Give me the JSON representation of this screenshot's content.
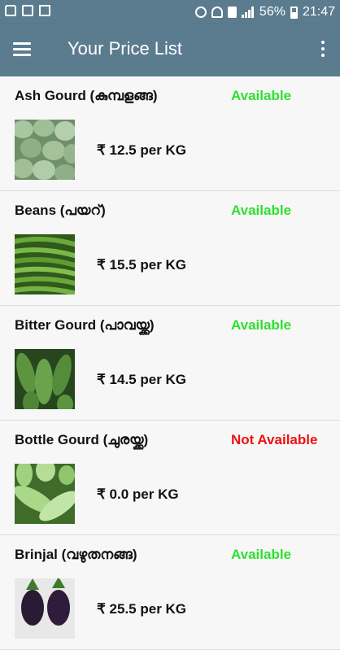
{
  "status_bar": {
    "battery": "56%",
    "time": "21:47",
    "icons": [
      "lock-icon",
      "notification-icon",
      "flag-icon",
      "mute-icon",
      "wifi-icon",
      "sim-icon",
      "signal-icon",
      "battery-icon"
    ]
  },
  "app_bar": {
    "title": "Your Price List",
    "menu_icon": "hamburger-menu-icon",
    "more_icon": "more-vert-icon"
  },
  "colors": {
    "app_bar": "#5b7c8e",
    "available": "#2ee02e",
    "not_available": "#ee1111"
  },
  "items": [
    {
      "name": "Ash Gourd (കുമ്പളങ്ങ)",
      "status": "Available",
      "price": "₹ 12.5 per KG",
      "image": "ash-gourd-image"
    },
    {
      "name": "Beans (പയറ്)",
      "status": "Available",
      "price": "₹ 15.5 per KG",
      "image": "beans-image"
    },
    {
      "name": "Bitter Gourd (പാവയ്ക്ക)",
      "status": "Available",
      "price": "₹ 14.5 per KG",
      "image": "bitter-gourd-image"
    },
    {
      "name": "Bottle Gourd (ചുരയ്ക്ക)",
      "status": "Not Available",
      "price": "₹ 0.0 per KG",
      "image": "bottle-gourd-image"
    },
    {
      "name": "Brinjal (വഴുതനങ്ങ)",
      "status": "Available",
      "price": "₹ 25.5 per KG",
      "image": "brinjal-image"
    }
  ]
}
